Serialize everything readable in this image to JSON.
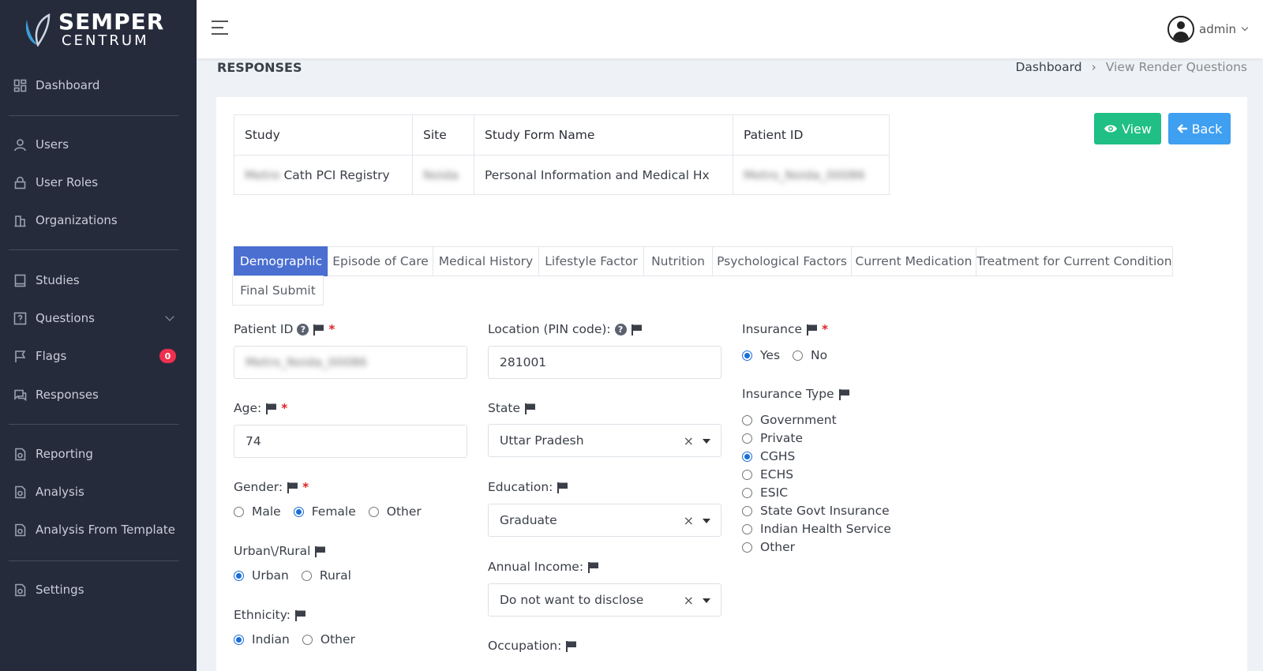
{
  "brand": {
    "line1": "SEMPER",
    "line2": "CENTRUM"
  },
  "nav": {
    "dashboard": "Dashboard",
    "users": "Users",
    "user_roles": "User Roles",
    "organizations": "Organizations",
    "studies": "Studies",
    "questions": "Questions",
    "flags": "Flags",
    "flags_count": "0",
    "responses": "Responses",
    "reporting": "Reporting",
    "analysis": "Analysis",
    "analysis_template": "Analysis From Template",
    "settings": "Settings"
  },
  "user": {
    "name": "admin"
  },
  "page": {
    "title": "RESPONSES"
  },
  "breadcrumb": {
    "home": "Dashboard",
    "current": "View Render Questions"
  },
  "info": {
    "headers": {
      "study": "Study",
      "site": "Site",
      "form": "Study Form Name",
      "patient": "Patient ID"
    },
    "study_blur": "Metro",
    "study_name": "Cath PCI Registry",
    "site": "Noida",
    "form": "Personal Information and Medical Hx",
    "patient": "Metro_Noida_00086"
  },
  "buttons": {
    "view": "View",
    "back": "Back"
  },
  "tabs": {
    "demographic": "Demographic",
    "episode": "Episode of Care",
    "medical_history": "Medical History",
    "lifestyle": "Lifestyle Factor",
    "nutrition": "Nutrition",
    "psych": "Psychological Factors",
    "medication": "Current Medication",
    "treatment": "Treatment for Current Condition",
    "final": "Final Submit"
  },
  "form": {
    "patient_id": {
      "label": "Patient ID",
      "value": "Metro_Noida_00086"
    },
    "age": {
      "label": "Age:",
      "value": "74"
    },
    "gender": {
      "label": "Gender:",
      "options": [
        "Male",
        "Female",
        "Other"
      ],
      "selected": "Female"
    },
    "urban_rural": {
      "label": "Urban\\/Rural",
      "options": [
        "Urban",
        "Rural"
      ],
      "selected": "Urban"
    },
    "ethnicity": {
      "label": "Ethnicity:",
      "options": [
        "Indian",
        "Other"
      ],
      "selected": "Indian"
    },
    "location": {
      "label": "Location (PIN code):",
      "value": "281001"
    },
    "state": {
      "label": "State",
      "value": "Uttar Pradesh"
    },
    "education": {
      "label": "Education:",
      "value": "Graduate"
    },
    "income": {
      "label": "Annual Income:",
      "value": "Do not want to disclose"
    },
    "occupation": {
      "label": "Occupation:"
    },
    "insurance": {
      "label": "Insurance",
      "options": [
        "Yes",
        "No"
      ],
      "selected": "Yes"
    },
    "insurance_type": {
      "label": "Insurance Type",
      "options": [
        "Government",
        "Private",
        "CGHS",
        "ECHS",
        "ESIC",
        "State Govt Insurance",
        "Indian Health Service",
        "Other"
      ],
      "selected": "CGHS"
    }
  },
  "colors": {
    "sidebar": "#262b3c",
    "active_tab": "#4a6fd1",
    "view_btn": "#1fbf85",
    "back_btn": "#3f9ff1",
    "badge": "#f0304e"
  }
}
